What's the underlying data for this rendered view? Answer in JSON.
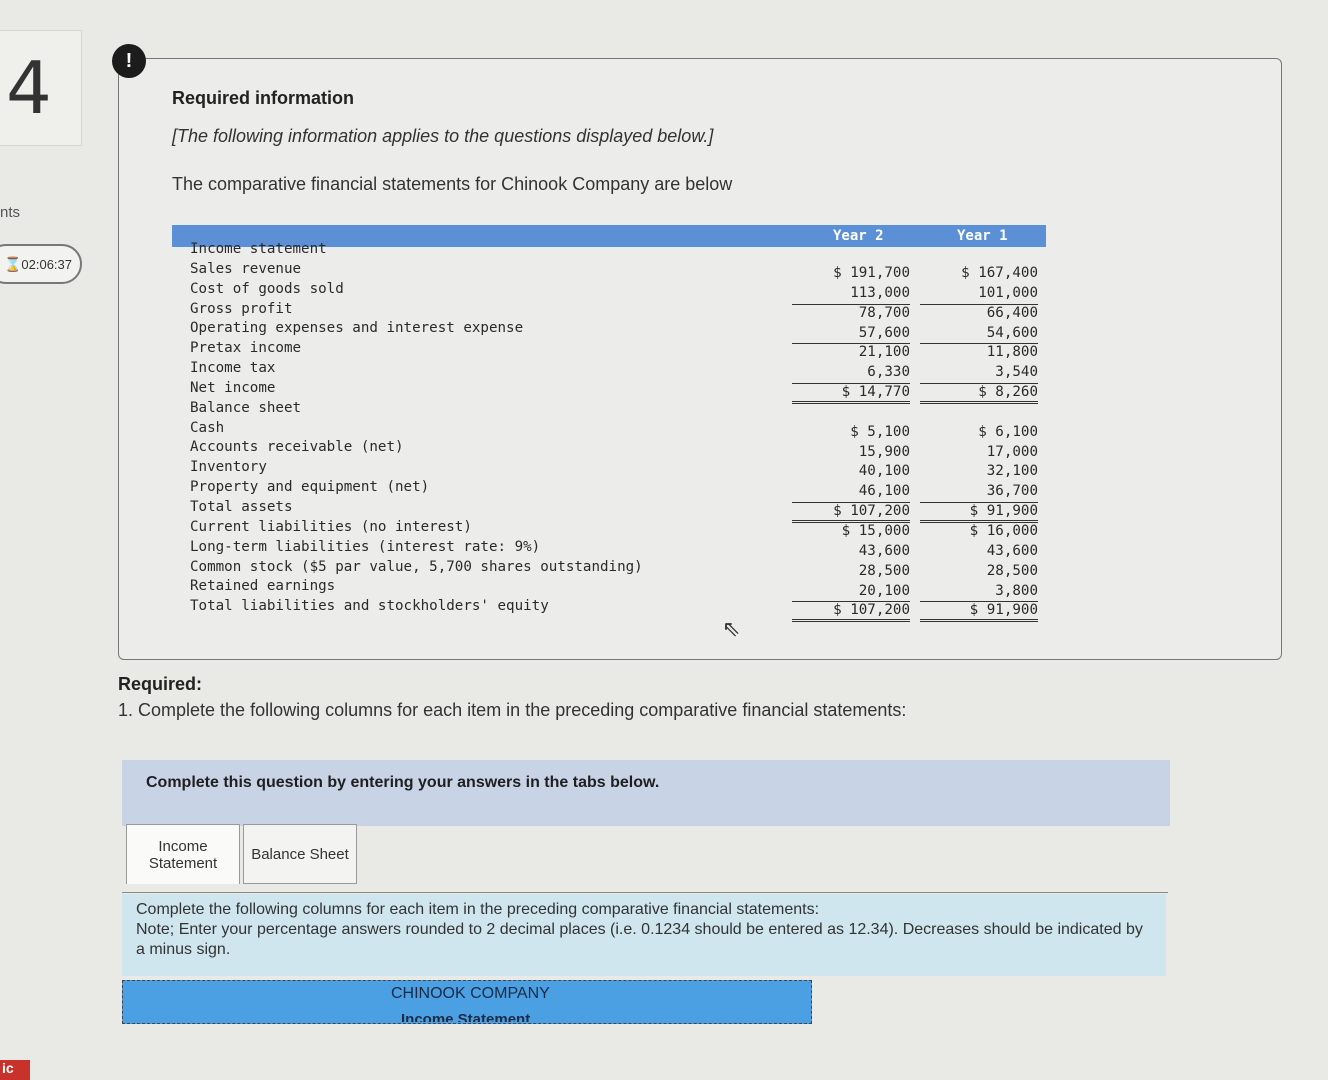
{
  "sidebar": {
    "question_number": "4",
    "points_label": "nts",
    "timer": "02:06:37",
    "bottom_badge": "ic"
  },
  "info": {
    "title": "Required information",
    "note": "[The following information applies to the questions displayed below.]",
    "intro": "The comparative financial statements for Chinook Company are below"
  },
  "financials": {
    "col_headers": [
      "Year 2",
      "Year 1"
    ],
    "labels": [
      "Income statement",
      "Sales revenue",
      "Cost of goods sold",
      "Gross profit",
      "Operating expenses and interest expense",
      "Pretax income",
      "Income tax",
      "Net income",
      "Balance sheet",
      "Cash",
      "Accounts receivable (net)",
      "Inventory",
      "Property and equipment (net)",
      "Total assets",
      "Current liabilities (no interest)",
      "Long-term liabilities (interest rate: 9%)",
      "Common stock ($5 par value, 5,700 shares outstanding)",
      "Retained earnings",
      "Total liabilities and stockholders' equity"
    ],
    "year2": [
      "$ 191,700",
      "113,000",
      "78,700",
      "57,600",
      "21,100",
      "6,330",
      "$ 14,770",
      "",
      "$ 5,100",
      "15,900",
      "40,100",
      "46,100",
      "$ 107,200",
      "$ 15,000",
      "43,600",
      "28,500",
      "20,100",
      "$ 107,200"
    ],
    "year1": [
      "$ 167,400",
      "101,000",
      "66,400",
      "54,600",
      "11,800",
      "3,540",
      "$ 8,260",
      "",
      "$ 6,100",
      "17,000",
      "32,100",
      "36,700",
      "$ 91,900",
      "$ 16,000",
      "43,600",
      "28,500",
      "3,800",
      "$ 91,900"
    ]
  },
  "required": {
    "label": "Required:",
    "item": "1. Complete the following columns for each item in the preceding comparative financial statements:"
  },
  "instructions": "Complete this question by entering your answers in the tabs below.",
  "tabs": {
    "income_line1": "Income",
    "income_line2": "Statement",
    "balance": "Balance Sheet"
  },
  "note": {
    "line1": "Complete the following columns for each item in the preceding comparative financial statements:",
    "line2": "Note; Enter your percentage answers rounded to 2 decimal places (i.e. 0.1234 should be entered as 12.34). Decreases should be indicated by a minus sign."
  },
  "company": {
    "name": "CHINOOK COMPANY",
    "statement": "Income Statement"
  }
}
